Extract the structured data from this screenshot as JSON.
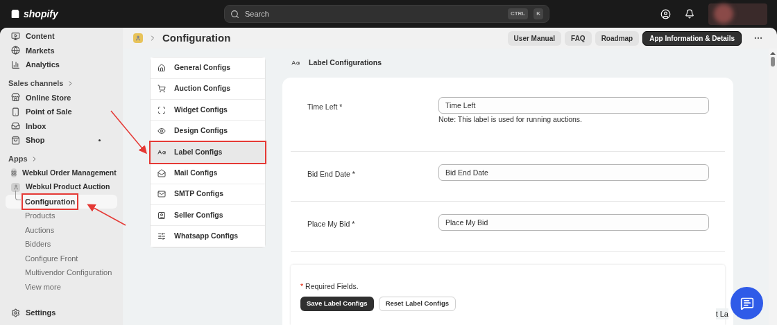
{
  "topbar": {
    "logo": "shopify",
    "search": {
      "placeholder": "Search"
    },
    "shortcut_keys": [
      "CTRL",
      "K"
    ]
  },
  "sidebar": {
    "items": [
      {
        "label": "Content",
        "kind": "nav"
      },
      {
        "label": "Markets",
        "kind": "nav"
      },
      {
        "label": "Analytics",
        "kind": "nav"
      },
      {
        "label": "Sales channels",
        "kind": "heading"
      },
      {
        "label": "Online Store",
        "kind": "nav"
      },
      {
        "label": "Point of Sale",
        "kind": "nav"
      },
      {
        "label": "Inbox",
        "kind": "nav"
      },
      {
        "label": "Shop",
        "kind": "nav"
      },
      {
        "label": "Apps",
        "kind": "heading"
      },
      {
        "label": "Webkul Order Management",
        "kind": "app"
      },
      {
        "label": "Webkul Product Auction",
        "kind": "app"
      },
      {
        "label": "Configuration",
        "kind": "sub",
        "selected": true,
        "outlined": true
      },
      {
        "label": "Products",
        "kind": "sub",
        "selected": false,
        "outlined": false
      },
      {
        "label": "Auctions",
        "kind": "sub",
        "selected": false,
        "outlined": false
      },
      {
        "label": "Bidders",
        "kind": "sub",
        "selected": false,
        "outlined": false
      },
      {
        "label": "Configure Front",
        "kind": "sub",
        "selected": false,
        "outlined": false
      },
      {
        "label": "Multivendor Configuration",
        "kind": "sub",
        "selected": false,
        "outlined": false
      },
      {
        "label": "View more",
        "kind": "sub",
        "selected": false,
        "outlined": false
      }
    ],
    "settings": "Settings"
  },
  "header": {
    "title": "Configuration",
    "buttons": [
      {
        "label": "User Manual",
        "kind": "secondary"
      },
      {
        "label": "FAQ",
        "kind": "secondary"
      },
      {
        "label": "Roadmap",
        "kind": "secondary"
      },
      {
        "label": "App Information & Details",
        "kind": "primary"
      }
    ]
  },
  "config_menu": [
    {
      "label": "General Configs",
      "selected": false,
      "outlined": false
    },
    {
      "label": "Auction Configs",
      "selected": false,
      "outlined": false
    },
    {
      "label": "Widget Configs",
      "selected": false,
      "outlined": false
    },
    {
      "label": "Design Configs",
      "selected": false,
      "outlined": false
    },
    {
      "label": "Label Configs",
      "selected": true,
      "outlined": true
    },
    {
      "label": "Mail Configs",
      "selected": false,
      "outlined": false
    },
    {
      "label": "SMTP Configs",
      "selected": false,
      "outlined": false
    },
    {
      "label": "Seller Configs",
      "selected": false,
      "outlined": false
    },
    {
      "label": "Whatsapp Configs",
      "selected": false,
      "outlined": false
    }
  ],
  "form": {
    "title": "Label Configurations",
    "fields": [
      {
        "label": "Time Left *",
        "value": "Time Left",
        "note": "Note: This label is used for running auctions."
      },
      {
        "label": "Bid End Date *",
        "value": "Bid End Date"
      },
      {
        "label": "Place My Bid *",
        "value": "Place My Bid"
      }
    ],
    "required_mark": "*",
    "required_text": "Required Fields.",
    "buttons": [
      {
        "label": "Save Label Configs",
        "kind": "primary"
      },
      {
        "label": "Reset Label Configs",
        "kind": "secondary"
      }
    ]
  },
  "overflow_text": "t La"
}
